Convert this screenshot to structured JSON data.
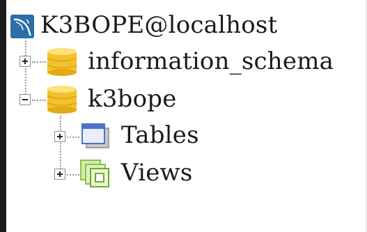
{
  "tree": {
    "connection": {
      "label": "K3BOPE@localhost",
      "icon": "mysql-dolphin-icon"
    },
    "databases": [
      {
        "label": "information_schema",
        "icon": "database-icon",
        "expanded": false
      },
      {
        "label": "k3bope",
        "icon": "database-icon",
        "expanded": true,
        "children": [
          {
            "label": "Tables",
            "icon": "tables-icon",
            "expanded": false
          },
          {
            "label": "Views",
            "icon": "views-icon",
            "expanded": false
          }
        ]
      }
    ]
  },
  "colors": {
    "database_gold": "#f2c12e",
    "tables_blue": "#4a74c9",
    "views_green": "#8cc63e",
    "connection_icon_bg": "#2d6ea8"
  }
}
